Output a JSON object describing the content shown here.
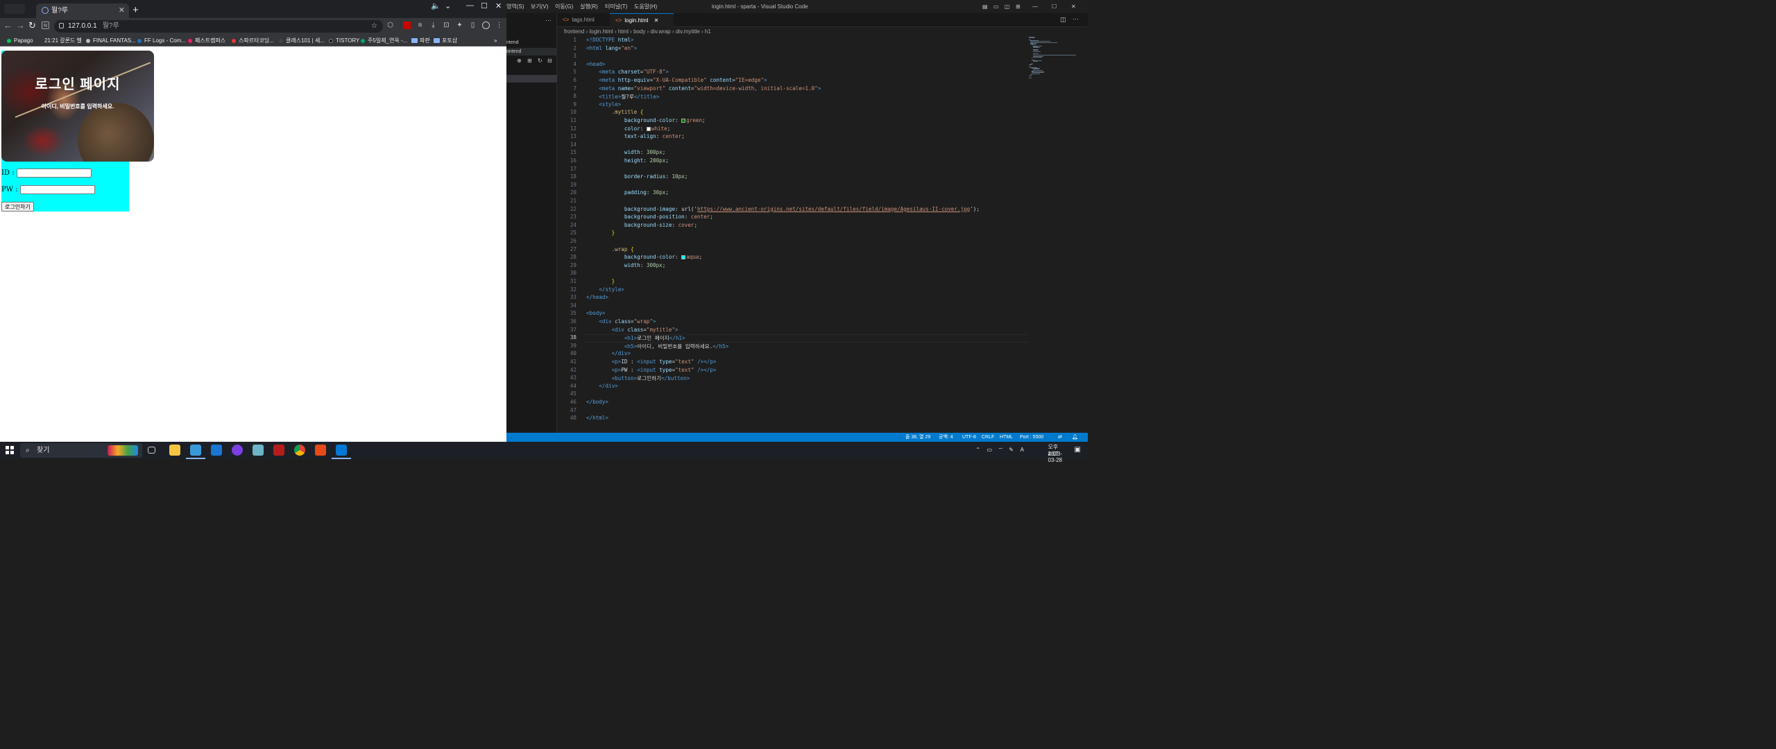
{
  "browser": {
    "tab_title": "뭘?루",
    "address": "127.0.0.1",
    "address_sub": "뭘?루",
    "bookmarks": [
      "Papago",
      "21:21 갈론드 벨",
      "FINAL FANTAS...",
      "FF Logs - Com...",
      "패스트캠퍼스",
      "스파르타코딩...",
      "클래스101 | 세...",
      "TISTORY",
      "주5일제_연옥 -...",
      "파판",
      "포토샵"
    ]
  },
  "page": {
    "heading": "로그인 페이지",
    "subheading": "아이디, 비밀번호를 입력하세요.",
    "id_label": "ID :",
    "pw_label": "PW :",
    "login_button": "로그인하기"
  },
  "vscode": {
    "window_title": "login.html - sparta - Visual Studio Code",
    "menus": [
      "영역(S)",
      "보기(V)",
      "이동(G)",
      "실행(R)",
      "터미널(T)",
      "도움말(H)"
    ],
    "sidebar_items": [
      "ntend",
      "ontend"
    ],
    "tabs": [
      "tags.html",
      "login.html"
    ],
    "breadcrumb": [
      "frontend",
      "login.html",
      "html",
      "body",
      "div.wrap",
      "div.mytitle",
      "h1"
    ],
    "status": {
      "position": "줄 38, 열 29",
      "spaces": "공백: 4",
      "encoding": "UTF-8",
      "eol": "CRLF",
      "language": "HTML",
      "port": "Port : 5500"
    }
  },
  "code_lines": [
    "<!DOCTYPE html>",
    "<html lang=\"en\">",
    "",
    "<head>",
    "    <meta charset=\"UTF-8\">",
    "    <meta http-equiv=\"X-UA-Compatible\" content=\"IE=edge\">",
    "    <meta name=\"viewport\" content=\"width=device-width, initial-scale=1.0\">",
    "    <title>뭘?루</title>",
    "    <style>",
    "        .mytitle {",
    "            background-color: green;",
    "            color: white;",
    "            text-align: center;",
    "",
    "            width: 300px;",
    "            height: 200px;",
    "",
    "            border-radius: 10px;",
    "",
    "            padding: 30px;",
    "",
    "            background-image: url('https://www.ancient-origins.net/sites/default/files/field/image/Agesilaus-II-cover.jpg');",
    "            background-position: center;",
    "            background-size: cover;",
    "        }",
    "",
    "        .wrap {",
    "            background-color: aqua;",
    "            width: 300px;",
    "",
    "        }",
    "    </style>",
    "</head>",
    "",
    "<body>",
    "    <div class=\"wrap\">",
    "        <div class=\"mytitle\">",
    "            <h1>로그인 페이지</h1>",
    "            <h5>아이디, 비밀번호를 입력하세요.</h5>",
    "        </div>",
    "        <p>ID : <input type=\"text\" /></p>",
    "        <p>PW : <input type=\"text\" /></p>",
    "        <button>로그인하기</button>",
    "    </div>",
    "",
    "</body>",
    "",
    "</html>"
  ],
  "current_line": 38,
  "taskbar": {
    "search_placeholder": "찾기",
    "time": "오후 4:07",
    "date": "2023-03-28"
  },
  "colors": {
    "accent": "#007acc",
    "wrap_bg": "#00ffff"
  }
}
